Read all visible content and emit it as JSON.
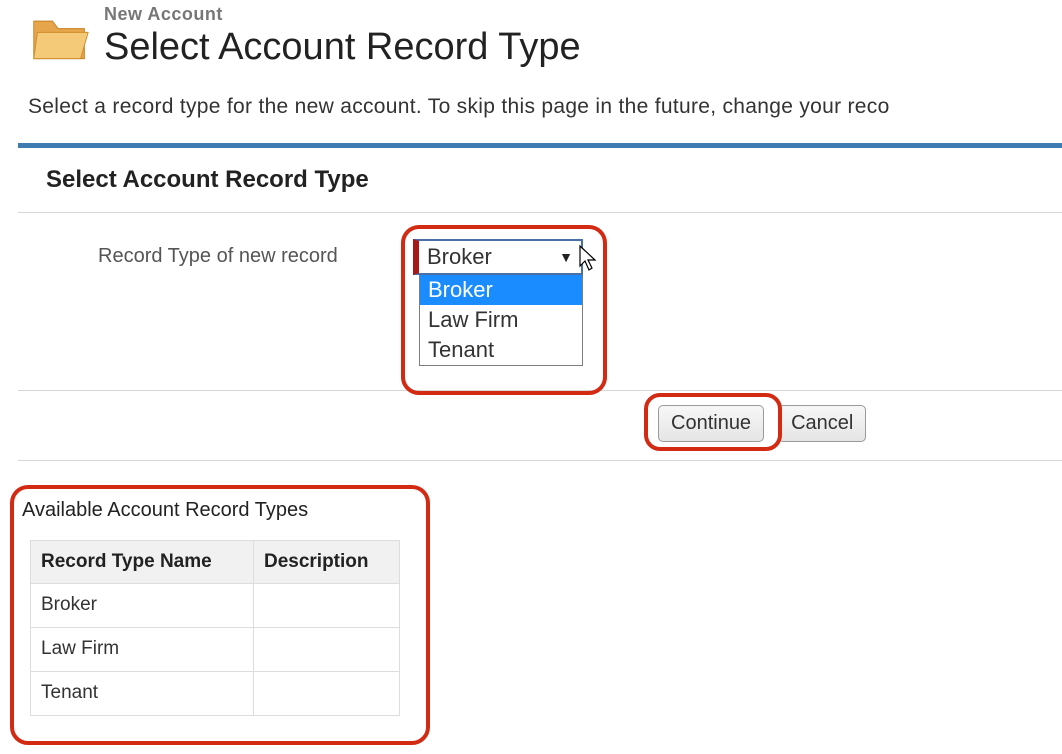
{
  "header": {
    "breadcrumb": "New Account",
    "title": "Select Account Record Type"
  },
  "instructions": "Select a record type for the new account. To skip this page in the future, change your reco",
  "panel": {
    "heading": "Select Account Record Type",
    "field_label": "Record Type of new record",
    "dropdown": {
      "selected": "Broker",
      "options": [
        "Broker",
        "Law Firm",
        "Tenant"
      ],
      "highlighted_index": 0
    }
  },
  "buttons": {
    "continue": "Continue",
    "cancel": "Cancel"
  },
  "available": {
    "heading": "Available Account Record Types",
    "columns": [
      "Record Type Name",
      "Description"
    ],
    "rows": [
      {
        "name": "Broker",
        "description": ""
      },
      {
        "name": "Law Firm",
        "description": ""
      },
      {
        "name": "Tenant",
        "description": ""
      }
    ]
  }
}
